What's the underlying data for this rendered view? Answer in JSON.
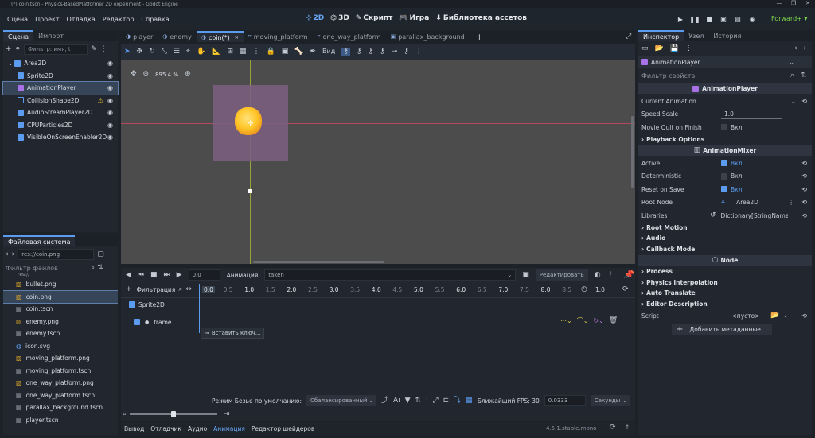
{
  "window": {
    "title": "(*) coin.tscn - Physics-BasedPlatformer 2D experiment - Godot Engine"
  },
  "menu": [
    "Сцена",
    "Проект",
    "Отладка",
    "Редактор",
    "Справка"
  ],
  "workspaces": [
    {
      "icon": "2d-icon",
      "label": "2D"
    },
    {
      "icon": "3d-icon",
      "label": "3D"
    },
    {
      "icon": "script-icon",
      "label": "Скрипт"
    },
    {
      "icon": "game-icon",
      "label": "Игра"
    },
    {
      "icon": "asset-library-icon",
      "label": "Библиотека ассетов"
    }
  ],
  "renderer": "Forward+",
  "scene_panel": {
    "tabs": [
      "Сцена",
      "Импорт"
    ],
    "filter_placeholder": "Фильтр: имя, t",
    "nodes": [
      {
        "name": "Area2D",
        "indent": 0,
        "color": "#5c9cf0",
        "warn": false
      },
      {
        "name": "Sprite2D",
        "indent": 1,
        "color": "#5c9cf0",
        "warn": false
      },
      {
        "name": "AnimationPlayer",
        "indent": 1,
        "color": "#a871e6",
        "warn": false,
        "selected": true
      },
      {
        "name": "CollisionShape2D",
        "indent": 1,
        "color": "#5c9cf0",
        "warn": true
      },
      {
        "name": "AudioStreamPlayer2D",
        "indent": 1,
        "color": "#5c9cf0",
        "warn": false
      },
      {
        "name": "CPUParticles2D",
        "indent": 1,
        "color": "#5c9cf0",
        "warn": false
      },
      {
        "name": "VisibleOnScreenEnabler2D",
        "indent": 1,
        "color": "#5c9cf0",
        "warn": false
      }
    ]
  },
  "fs_panel": {
    "tab": "Файловая система",
    "path": "res://coin.png",
    "filter": "Фильтр файлов",
    "partial": "res://",
    "files": [
      {
        "name": "bullet.png",
        "icon": "image"
      },
      {
        "name": "coin.png",
        "icon": "image",
        "selected": true
      },
      {
        "name": "coin.tscn",
        "icon": "scene"
      },
      {
        "name": "enemy.png",
        "icon": "image"
      },
      {
        "name": "enemy.tscn",
        "icon": "scene"
      },
      {
        "name": "icon.svg",
        "icon": "svg"
      },
      {
        "name": "moving_platform.png",
        "icon": "image"
      },
      {
        "name": "moving_platform.tscn",
        "icon": "scene"
      },
      {
        "name": "one_way_platform.png",
        "icon": "image"
      },
      {
        "name": "one_way_platform.tscn",
        "icon": "scene"
      },
      {
        "name": "parallax_background.tscn",
        "icon": "scene"
      },
      {
        "name": "player.tscn",
        "icon": "scene"
      }
    ]
  },
  "editor_tabs": [
    {
      "label": "player"
    },
    {
      "label": "enemy"
    },
    {
      "label": "coin(*)",
      "active": true
    },
    {
      "label": "moving_platform"
    },
    {
      "label": "one_way_platform"
    },
    {
      "label": "parallax_background"
    }
  ],
  "toolbar": {
    "view_label": "Вид"
  },
  "viewport": {
    "zoom": "895.4 %"
  },
  "animation": {
    "time": "0.0",
    "anim_label": "Анимация",
    "anim_name": "taken",
    "edit_label": "Редактировать",
    "filter_label": "Фильтрация",
    "length": "1.0",
    "ruler": [
      {
        "v": "0.0",
        "major": true
      },
      {
        "v": "0.5",
        "major": false
      },
      {
        "v": "1.0",
        "major": true
      },
      {
        "v": "1.5",
        "major": false
      },
      {
        "v": "2.0",
        "major": true
      },
      {
        "v": "2.5",
        "major": false
      },
      {
        "v": "3.0",
        "major": true
      },
      {
        "v": "3.5",
        "major": false
      },
      {
        "v": "4.0",
        "major": true
      },
      {
        "v": "4.5",
        "major": false
      },
      {
        "v": "5.0",
        "major": true
      },
      {
        "v": "5.5",
        "major": false
      },
      {
        "v": "6.0",
        "major": true
      },
      {
        "v": "6.5",
        "major": false
      },
      {
        "v": "7.0",
        "major": true
      },
      {
        "v": "7.5",
        "major": false
      },
      {
        "v": "8.0",
        "major": true
      },
      {
        "v": "8.5",
        "major": false
      }
    ],
    "track_node": "Sprite2D",
    "track_prop": "frame",
    "insert_key": "Вставить ключ...",
    "bezier_label": "Режим Безье по умолчанию:",
    "bezier_value": "Сбалансированный",
    "fps_label": "Ближайший FPS: 30",
    "step": "0.0333",
    "unit": "Секунды"
  },
  "bottom_tabs": [
    {
      "label": "Вывод"
    },
    {
      "label": "Отладчик"
    },
    {
      "label": "Аудио"
    },
    {
      "label": "Анимация",
      "active": true
    },
    {
      "label": "Редактор шейдеров"
    }
  ],
  "version": "4.5.1.stable.mono",
  "inspector": {
    "tabs": [
      "Инспектор",
      "Узел",
      "История"
    ],
    "node": "AnimationPlayer",
    "filter": "Фильтр свойств",
    "section1": "AnimationPlayer",
    "current_animation": "Current Animation",
    "speed_scale_label": "Speed Scale",
    "speed_scale": "1.0",
    "movie_quit_label": "Movie Quit on Finish",
    "on_label": "Вкл",
    "playback": "Playback Options",
    "section2": "AnimationMixer",
    "active_label": "Active",
    "deterministic_label": "Deterministic",
    "reset_label": "Reset on Save",
    "root_node_label": "Root Node",
    "root_node": "Area2D",
    "libraries_label": "Libraries",
    "libraries": "Dictionary[StringName,",
    "groups": [
      "Root Motion",
      "Audio",
      "Callback Mode"
    ],
    "section3": "Node",
    "groups2": [
      "Process",
      "Physics Interpolation",
      "Auto Translate",
      "Editor Description"
    ],
    "script_label": "Script",
    "script_value": "<пусто>",
    "add_meta": "Добавить метаданные"
  }
}
